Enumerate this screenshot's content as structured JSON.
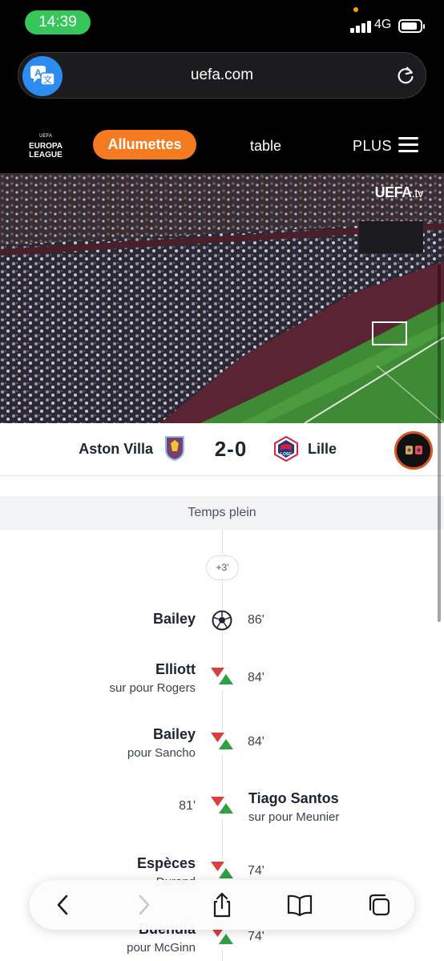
{
  "status_bar": {
    "time": "14:39",
    "network": "4G",
    "battery_level": 0.85
  },
  "browser": {
    "url": "uefa.com",
    "icons": [
      "translate-icon",
      "reload-icon"
    ]
  },
  "nav": {
    "logo_text": [
      "UEFA",
      "EUROPA",
      "LEAGUE"
    ],
    "active_tab": "Allumettes",
    "tab_table": "table",
    "tab_plus": "PLUS"
  },
  "video": {
    "watermark": "UEFA",
    "watermark_suffix": ".tv"
  },
  "match": {
    "home": "Aston Villa",
    "away": "Lille",
    "score": "2-0",
    "away_crest_text": "LOSC"
  },
  "timeline": {
    "period": "Temps plein",
    "added_time": "+3'",
    "events": [
      {
        "type": "goal",
        "side": "home",
        "player": "Bailey",
        "detail": "",
        "minute": "86'"
      },
      {
        "type": "substitution",
        "side": "home",
        "player": "Elliott",
        "detail": "sur pour Rogers",
        "minute": "84'"
      },
      {
        "type": "substitution",
        "side": "home",
        "player": "Bailey",
        "detail": "pour Sancho",
        "minute": "84'"
      },
      {
        "type": "substitution",
        "side": "away",
        "player": "Tiago Santos",
        "detail": "sur pour Meunier",
        "minute": "81'"
      },
      {
        "type": "substitution",
        "side": "home",
        "player": "Espèces",
        "detail": "Durand",
        "minute": "74'"
      },
      {
        "type": "substitution",
        "side": "home",
        "player": "Buendía",
        "detail": "pour McGinn",
        "minute": "74'"
      }
    ]
  },
  "toolbar": {
    "icons": [
      "back-icon",
      "forward-icon",
      "share-icon",
      "bookmarks-icon",
      "tabs-icon"
    ]
  },
  "colors": {
    "accent": "#f47b20",
    "sub_out": "#d94040",
    "sub_in": "#2f9e44",
    "status_pill": "#35c759"
  }
}
